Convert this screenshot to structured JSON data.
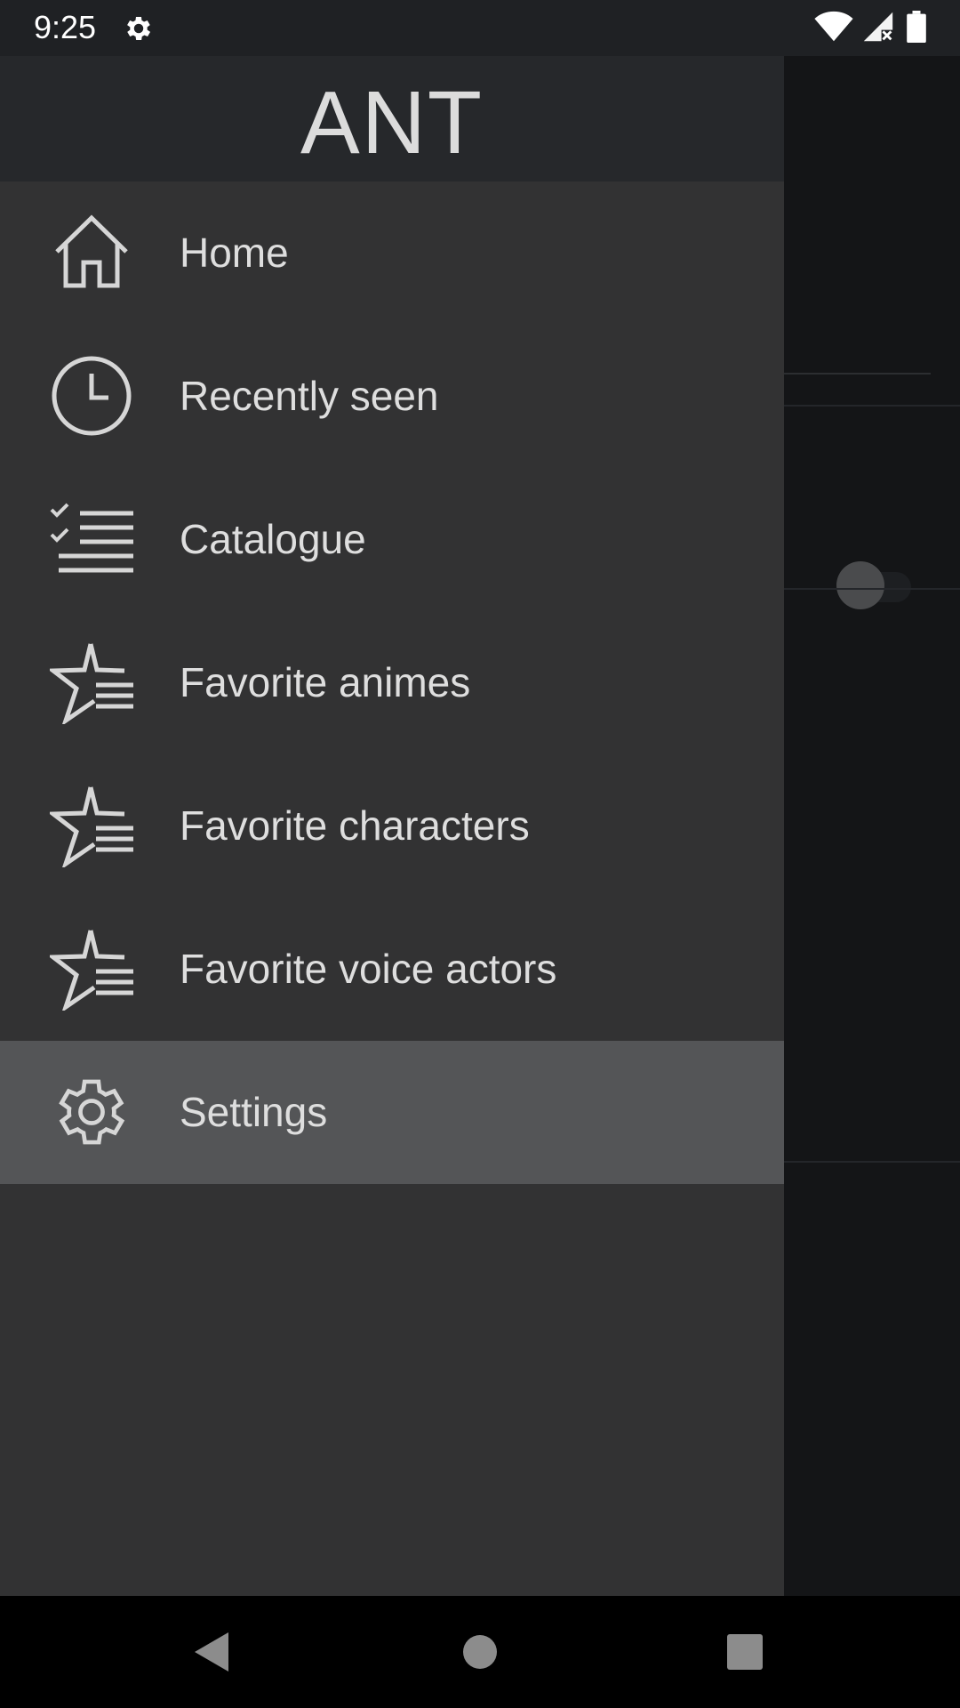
{
  "status_bar": {
    "time": "9:25",
    "icons": [
      "settings-gear-icon",
      "wifi-icon",
      "signal-icon",
      "battery-icon"
    ]
  },
  "drawer": {
    "title": "ANT",
    "items": [
      {
        "label": "Home",
        "icon": "home-icon",
        "selected": false
      },
      {
        "label": "Recently seen",
        "icon": "clock-icon",
        "selected": false
      },
      {
        "label": "Catalogue",
        "icon": "checklist-icon",
        "selected": false
      },
      {
        "label": "Favorite animes",
        "icon": "star-list-icon",
        "selected": false
      },
      {
        "label": "Favorite characters",
        "icon": "star-list-icon",
        "selected": false
      },
      {
        "label": "Favorite voice actors",
        "icon": "star-list-icon",
        "selected": false
      },
      {
        "label": "Settings",
        "icon": "gear-icon",
        "selected": true
      }
    ]
  },
  "nav_bar": {
    "buttons": [
      "back-icon",
      "home-circle-icon",
      "recents-icon"
    ]
  },
  "colors": {
    "drawer_bg": "#323233",
    "header_bg": "#26282b",
    "selected_bg": "#545557",
    "text": "#dedede"
  }
}
